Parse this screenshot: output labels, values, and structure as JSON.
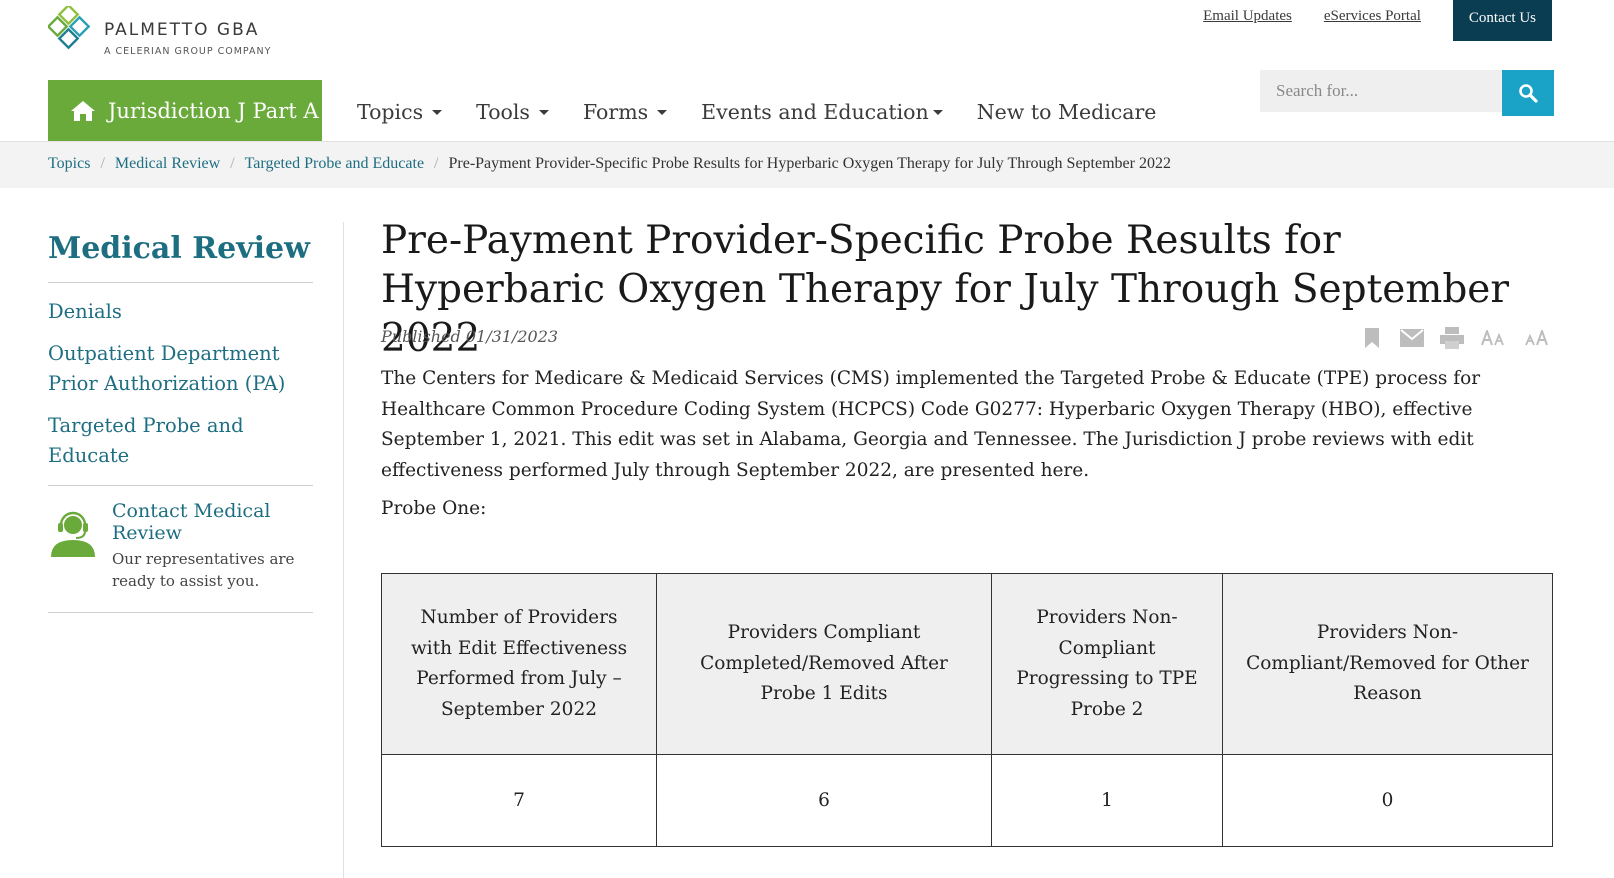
{
  "header": {
    "logo_name": "PALMETTO GBA",
    "logo_sub": "A CELERIAN GROUP COMPANY",
    "util_links": [
      "Email Updates",
      "eServices Portal"
    ],
    "contact_label": "Contact Us",
    "jurisdiction": "Jurisdiction J Part A",
    "nav": [
      "Topics",
      "Tools",
      "Forms",
      "Events and Education",
      "New to Medicare"
    ],
    "search_placeholder": "Search for..."
  },
  "breadcrumb": {
    "items": [
      "Topics",
      "Medical Review",
      "Targeted Probe and Educate"
    ],
    "current": "Pre-Payment Provider-Specific Probe Results for Hyperbaric Oxygen Therapy for July Through September 2022"
  },
  "sidebar": {
    "title": "Medical Review",
    "links": [
      "Denials",
      "Outpatient Department Prior Authorization (PA)",
      "Targeted Probe and Educate"
    ],
    "contact_title": "Contact Medical Review",
    "contact_sub": "Our representatives are ready to assist you."
  },
  "article": {
    "title": "Pre-Payment Provider-Specific Probe Results for Hyperbaric Oxygen Therapy for July Through September 2022",
    "published": "Published 01/31/2023",
    "intro": "The Centers for Medicare & Medicaid Services (CMS) implemented the Targeted Probe & Educate (TPE) process for Healthcare Common Procedure Coding System (HCPCS) Code G0277: Hyperbaric Oxygen Therapy (HBO), effective September 1, 2021. This edit was set in Alabama, Georgia and Tennessee. The Jurisdiction J probe reviews with edit effectiveness performed July through September 2022, are presented here.",
    "probe_label": "Probe One:",
    "table": {
      "headers": [
        "Number of Providers with Edit Effectiveness Performed from July – September 2022",
        "Providers Compliant Completed/Removed After Probe 1 Edits",
        "Providers Non-Compliant Progressing to TPE Probe 2",
        "Providers Non-Compliant/Removed for Other Reason"
      ],
      "row": [
        "7",
        "6",
        "1",
        "0"
      ]
    }
  },
  "colors": {
    "brand_green": "#6aaa3a",
    "link_teal": "#1e6e82",
    "navy": "#0a3d52",
    "search_blue": "#1aa3c7"
  }
}
